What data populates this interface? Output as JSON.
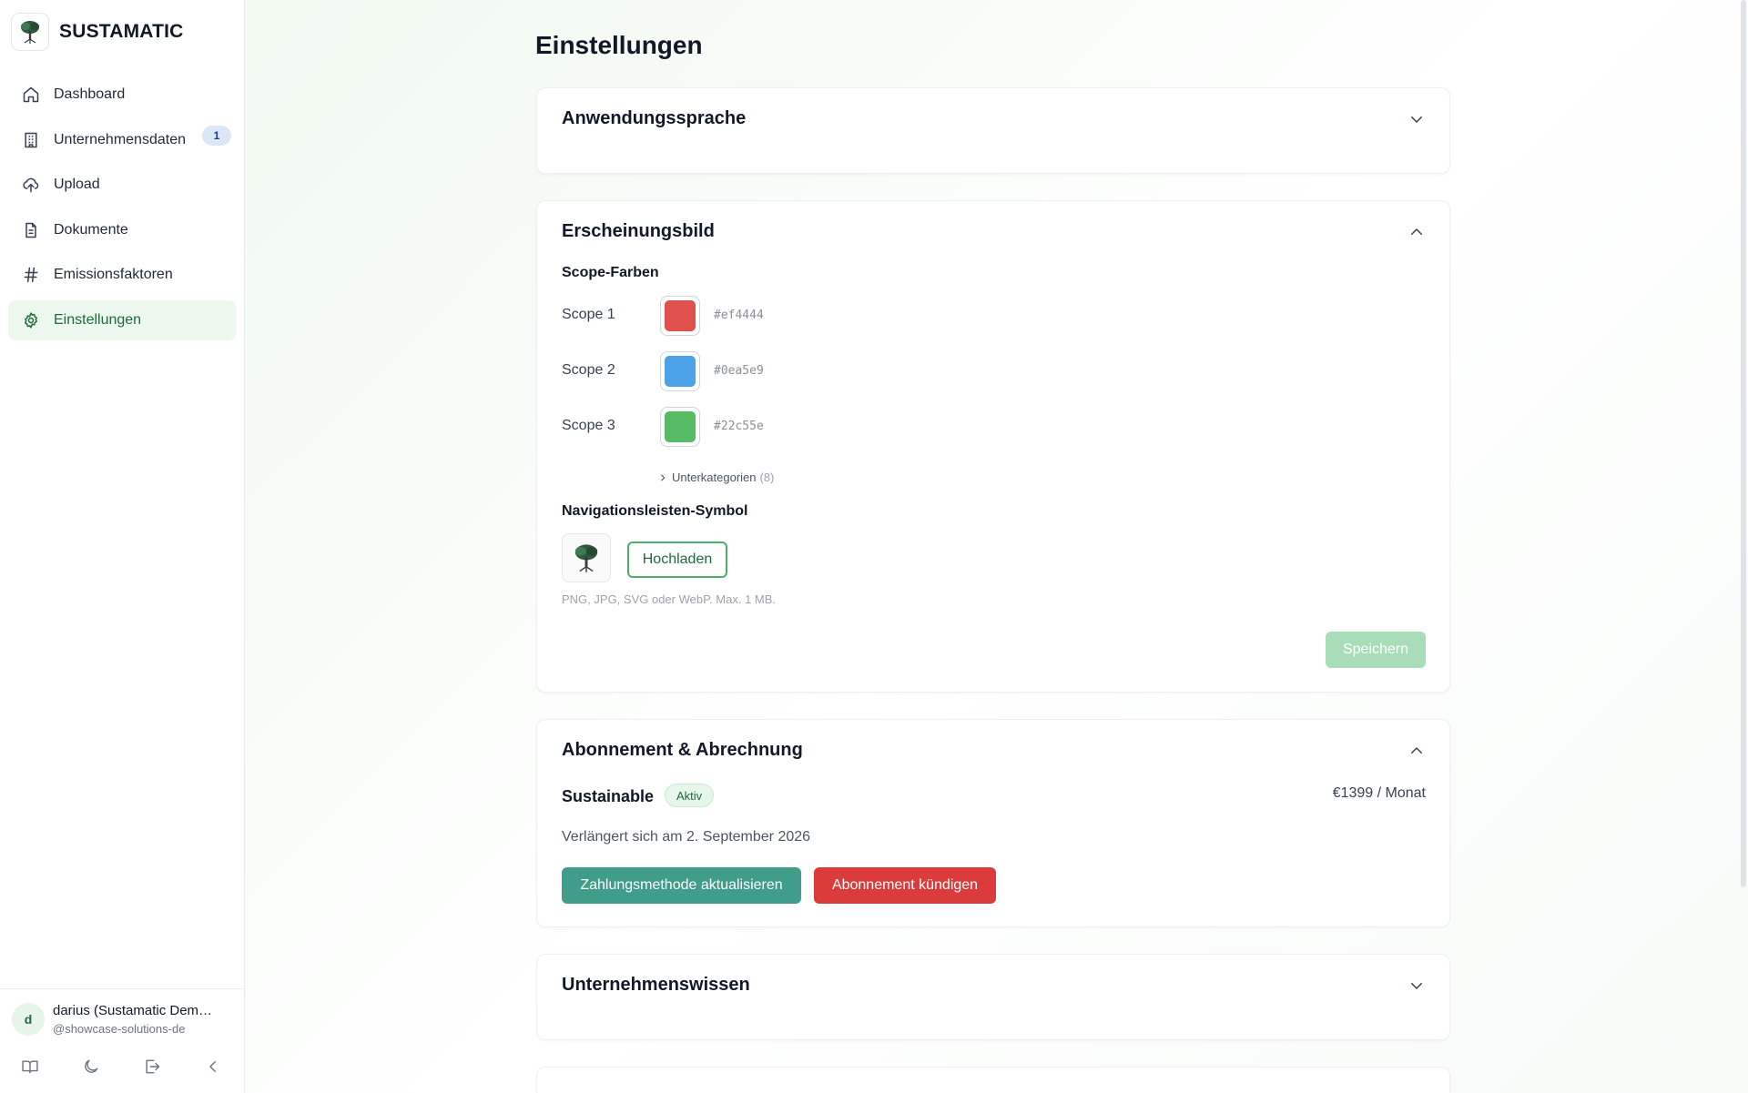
{
  "app": {
    "brand_name": "SUSTAMATIC",
    "brand_icon": "tree-logo-icon"
  },
  "sidebar": {
    "items": [
      {
        "label": "Dashboard",
        "icon": "home-icon",
        "active": false
      },
      {
        "label": "Unternehmensdaten",
        "icon": "building-icon",
        "active": false,
        "badge": "1"
      },
      {
        "label": "Upload",
        "icon": "cloud-upload-icon",
        "active": false
      },
      {
        "label": "Dokumente",
        "icon": "document-icon",
        "active": false
      },
      {
        "label": "Emissionsfaktoren",
        "icon": "hash-icon",
        "active": false
      },
      {
        "label": "Einstellungen",
        "icon": "gear-icon",
        "active": true
      }
    ],
    "user": {
      "initial": "d",
      "name": "darius (Sustamatic Dem…",
      "handle": "@showcase-solutions-de"
    },
    "footer_icons": [
      "book-icon",
      "moon-icon",
      "logout-icon",
      "chevron-left-icon"
    ]
  },
  "main": {
    "page_title": "Einstellungen",
    "language_card": {
      "title": "Anwendungssprache",
      "expanded": false
    },
    "appearance_card": {
      "title": "Erscheinungsbild",
      "expanded": true,
      "scope_colors_heading": "Scope-Farben",
      "scopes": [
        {
          "label": "Scope 1",
          "color": "#ef4444",
          "hex": "#ef4444"
        },
        {
          "label": "Scope 2",
          "color": "#0ea5e9",
          "hex": "#0ea5e9"
        },
        {
          "label": "Scope 3",
          "color": "#22c55e",
          "hex": "#22c55e"
        }
      ],
      "subcategories_label": "Unterkategorien",
      "subcategories_count": "(8)",
      "nav_icon_heading": "Navigationsleisten-Symbol",
      "upload_button": "Hochladen",
      "upload_hint": "PNG, JPG, SVG oder WebP. Max. 1 MB.",
      "save_button": "Speichern"
    },
    "subscription_card": {
      "title": "Abonnement & Abrechnung",
      "expanded": true,
      "plan_name": "Sustainable",
      "status": "Aktiv",
      "price": "€1399 / Monat",
      "renewal": "Verlängert sich am 2. September 2026",
      "update_payment_button": "Zahlungsmethode aktualisieren",
      "cancel_button": "Abonnement kündigen"
    },
    "knowledge_card": {
      "title": "Unternehmenswissen",
      "expanded": false
    }
  },
  "colors": {
    "brand_green": "#1e6b3a",
    "active_bg": "#ecf7ee",
    "teal_button": "#3f9d8a",
    "red_button": "#dc3b3b",
    "save_disabled": "#a9ddb8"
  }
}
